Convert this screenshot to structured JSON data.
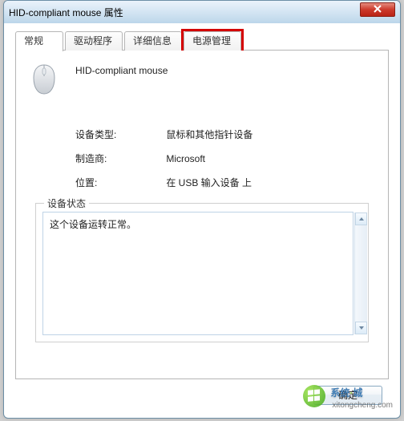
{
  "window": {
    "title": "HID-compliant mouse 属性"
  },
  "tabs": [
    {
      "label": "常规"
    },
    {
      "label": "驱动程序"
    },
    {
      "label": "详细信息"
    },
    {
      "label": "电源管理"
    }
  ],
  "device": {
    "name": "HID-compliant mouse",
    "type_label": "设备类型:",
    "type_value": "鼠标和其他指针设备",
    "manufacturer_label": "制造商:",
    "manufacturer_value": "Microsoft",
    "location_label": "位置:",
    "location_value": "在 USB 输入设备 上"
  },
  "status": {
    "group_title": "设备状态",
    "text": "这个设备运转正常。"
  },
  "buttons": {
    "ok": "确定"
  },
  "watermark": {
    "text1": "系统",
    "dot": "·",
    "text2": "城",
    "sub": "xitongcheng.com"
  },
  "icons": {
    "close": "close-icon",
    "mouse": "mouse-icon"
  }
}
